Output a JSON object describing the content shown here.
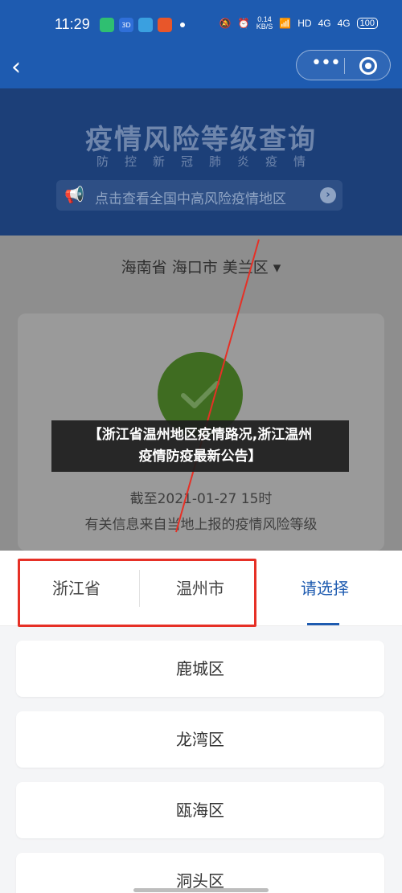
{
  "status_bar": {
    "time": "11:29",
    "apps": [
      {
        "label": "",
        "color": "#2fbf71"
      },
      {
        "label": "3D",
        "color": "#2f6fd8"
      },
      {
        "label": "",
        "color": "#3aa0e0"
      },
      {
        "label": "",
        "color": "#e8562a"
      }
    ],
    "speed_value": "0.14",
    "speed_unit": "KB/S",
    "hd": "HD",
    "net1": "4G",
    "net2": "4G",
    "battery": "100"
  },
  "nav": {
    "back_icon": "‹",
    "more_icon": "•••"
  },
  "banner": {
    "title": "疫情风险等级查询",
    "subtitle": "防控新冠肺炎疫情",
    "notice_text": "点击查看全国中高风险疫情地区",
    "notice_arrow": "›"
  },
  "region": {
    "selected": "海南省 海口市 美兰区 ▾"
  },
  "result": {
    "time_text": "截至2021-01-27 15时",
    "note": "有关信息来自当地上报的疫情风险等级"
  },
  "overlay": {
    "line1": "【浙江省温州地区疫情路况,浙江温州",
    "line2": "疫情防疫最新公告】"
  },
  "picker": {
    "tabs": [
      "浙江省",
      "温州市",
      "请选择"
    ],
    "districts": [
      "鹿城区",
      "龙湾区",
      "瓯海区",
      "洞头区"
    ]
  },
  "colors": {
    "brand": "#1e5bb0",
    "annotation_red": "#e63026",
    "check_green": "#3f6c21"
  }
}
